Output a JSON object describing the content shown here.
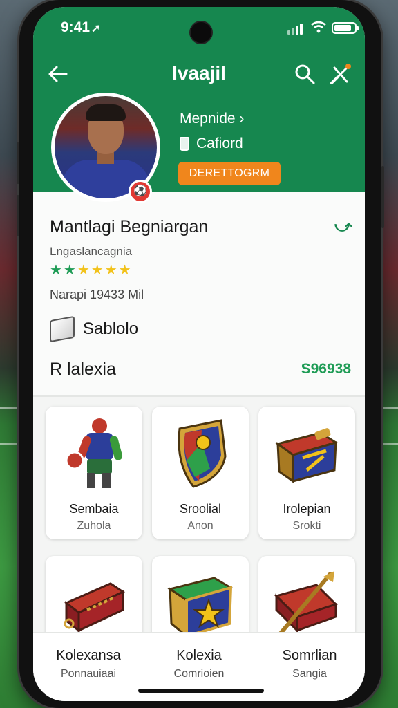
{
  "status_bar": {
    "time": "9:41",
    "nav_glyph": "➚",
    "battery_level": 0.85,
    "signal_bars": 4
  },
  "header": {
    "title": "Ivaajil",
    "link_label": "Mepnide",
    "link_chevron": "›",
    "club_label": "Cafiord",
    "action_button": "DERETTOGRM",
    "badge_glyph": "⚽"
  },
  "icons": {
    "back": "back-arrow-icon",
    "search": "search-icon",
    "tool": "tools-icon",
    "club": "cup-icon",
    "bundle": "box-icon"
  },
  "profile": {
    "name": "Mantlagi Begniargan",
    "subtitle": "Lngaslancagnia",
    "stars_green": "★★",
    "stars_yellow": "★★★★",
    "value": "Narapi 19433 Mil",
    "action_glyph": "⤻",
    "bundle_label": "Sablolo"
  },
  "collection": {
    "title": "R lalexia",
    "count": "S96938"
  },
  "cards": [
    {
      "name": "Sembaia",
      "sub": "Zuhola",
      "icon": "player-figure-icon"
    },
    {
      "name": "Sroolial",
      "sub": "Anon",
      "icon": "shield-emblem-icon"
    },
    {
      "name": "Irolepian",
      "sub": "Srokti",
      "icon": "treasure-chest-icon"
    },
    {
      "name": "",
      "sub": "",
      "icon": "red-bar-icon"
    },
    {
      "name": "",
      "sub": "",
      "icon": "star-shield-chest-icon"
    },
    {
      "name": "",
      "sub": "",
      "icon": "sword-box-icon"
    }
  ],
  "tabs": [
    {
      "label": "Kolexansa",
      "sub": "Ponnauiaai"
    },
    {
      "label": "Kolexia",
      "sub": "Comrioien"
    },
    {
      "label": "Somrlian",
      "sub": "Sangia"
    }
  ],
  "colors": {
    "brand_green": "#16874f",
    "accent_orange": "#f0861c",
    "count_green": "#1f9c56",
    "star_yellow": "#f2c21a",
    "badge_red": "#e13a34"
  }
}
